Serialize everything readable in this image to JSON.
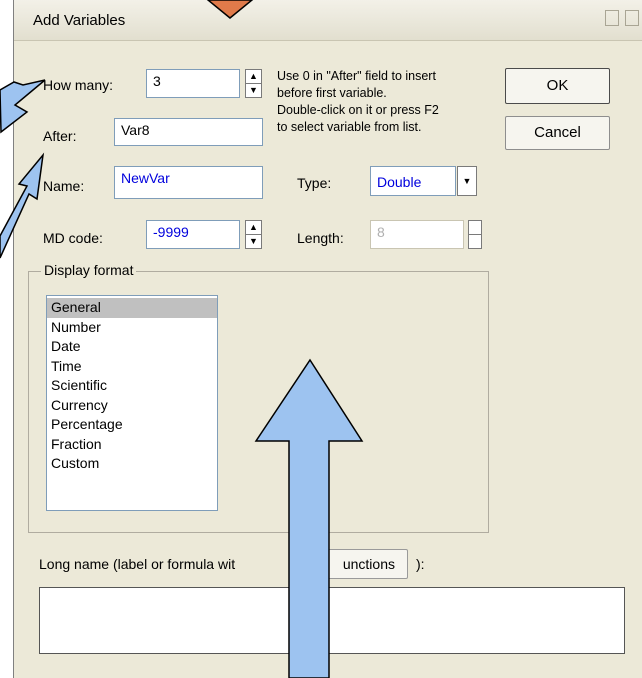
{
  "dialog": {
    "title": "Add Variables",
    "how_many": {
      "label": "How many:",
      "value": "3"
    },
    "after": {
      "label": "After:",
      "value": "Var8"
    },
    "name": {
      "label": "Name:",
      "value": "NewVar"
    },
    "type": {
      "label": "Type:",
      "value": "Double"
    },
    "md_code": {
      "label": "MD code:",
      "value": "-9999"
    },
    "length": {
      "label": "Length:",
      "value": "8"
    },
    "hint_lines": [
      "Use 0 in \"After\" field to insert",
      "before first variable.",
      "Double-click on it or press F2",
      "to select variable from list."
    ],
    "ok_label": "OK",
    "cancel_label": "Cancel",
    "display_format": {
      "title": "Display format",
      "items": [
        "General",
        "Number",
        "Date",
        "Time",
        "Scientific",
        "Currency",
        "Percentage",
        "Fraction",
        "Custom"
      ],
      "selected": "General"
    },
    "long_name": {
      "label": "Long name (label or formula wit",
      "functions_button": "unctions",
      "label_end": "):",
      "value": ""
    }
  },
  "colors": {
    "dialog_bg": "#ece9d8",
    "arrow_fill": "#9dc3f0",
    "arrow_top": "#e07a4a",
    "field_text_blue": "#0000dd"
  }
}
